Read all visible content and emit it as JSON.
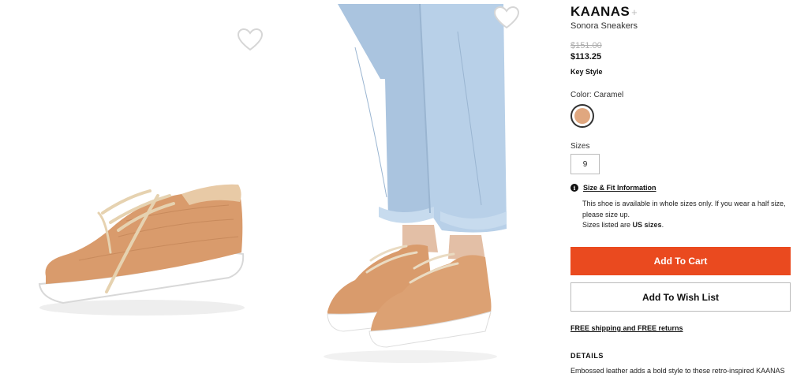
{
  "product": {
    "brand": "KAANAS",
    "brand_plus": "+",
    "name": "Sonora Sneakers",
    "price_original": "$151.00",
    "price_sale": "$113.25",
    "tag": "Key Style"
  },
  "color": {
    "label": "Color: Caramel",
    "swatch_hex": "#e0a77f"
  },
  "sizes": {
    "label": "Sizes",
    "options": [
      "9"
    ]
  },
  "size_fit": {
    "icon": "info-icon",
    "icon_glyph": "i",
    "link_label": "Size & Fit Information",
    "note": "This shoe is available in whole sizes only. If you wear a half size, please size up.",
    "sizes_prefix": "Sizes listed are ",
    "sizes_bold": "US sizes",
    "sizes_suffix": "."
  },
  "actions": {
    "add_to_cart": "Add To Cart",
    "add_to_wishlist": "Add To Wish List",
    "accent": "#ea4a1f"
  },
  "shipping": {
    "label": "FREE shipping and FREE returns"
  },
  "details": {
    "heading": "DETAILS",
    "text": "Embossed leather adds a bold style to these retro-inspired KAANAS"
  },
  "gallery": {
    "images": [
      {
        "name": "sneaker-side-view-image",
        "favorite_icon": "heart-icon"
      },
      {
        "name": "model-wearing-sneakers-image",
        "favorite_icon": "heart-icon"
      }
    ]
  }
}
